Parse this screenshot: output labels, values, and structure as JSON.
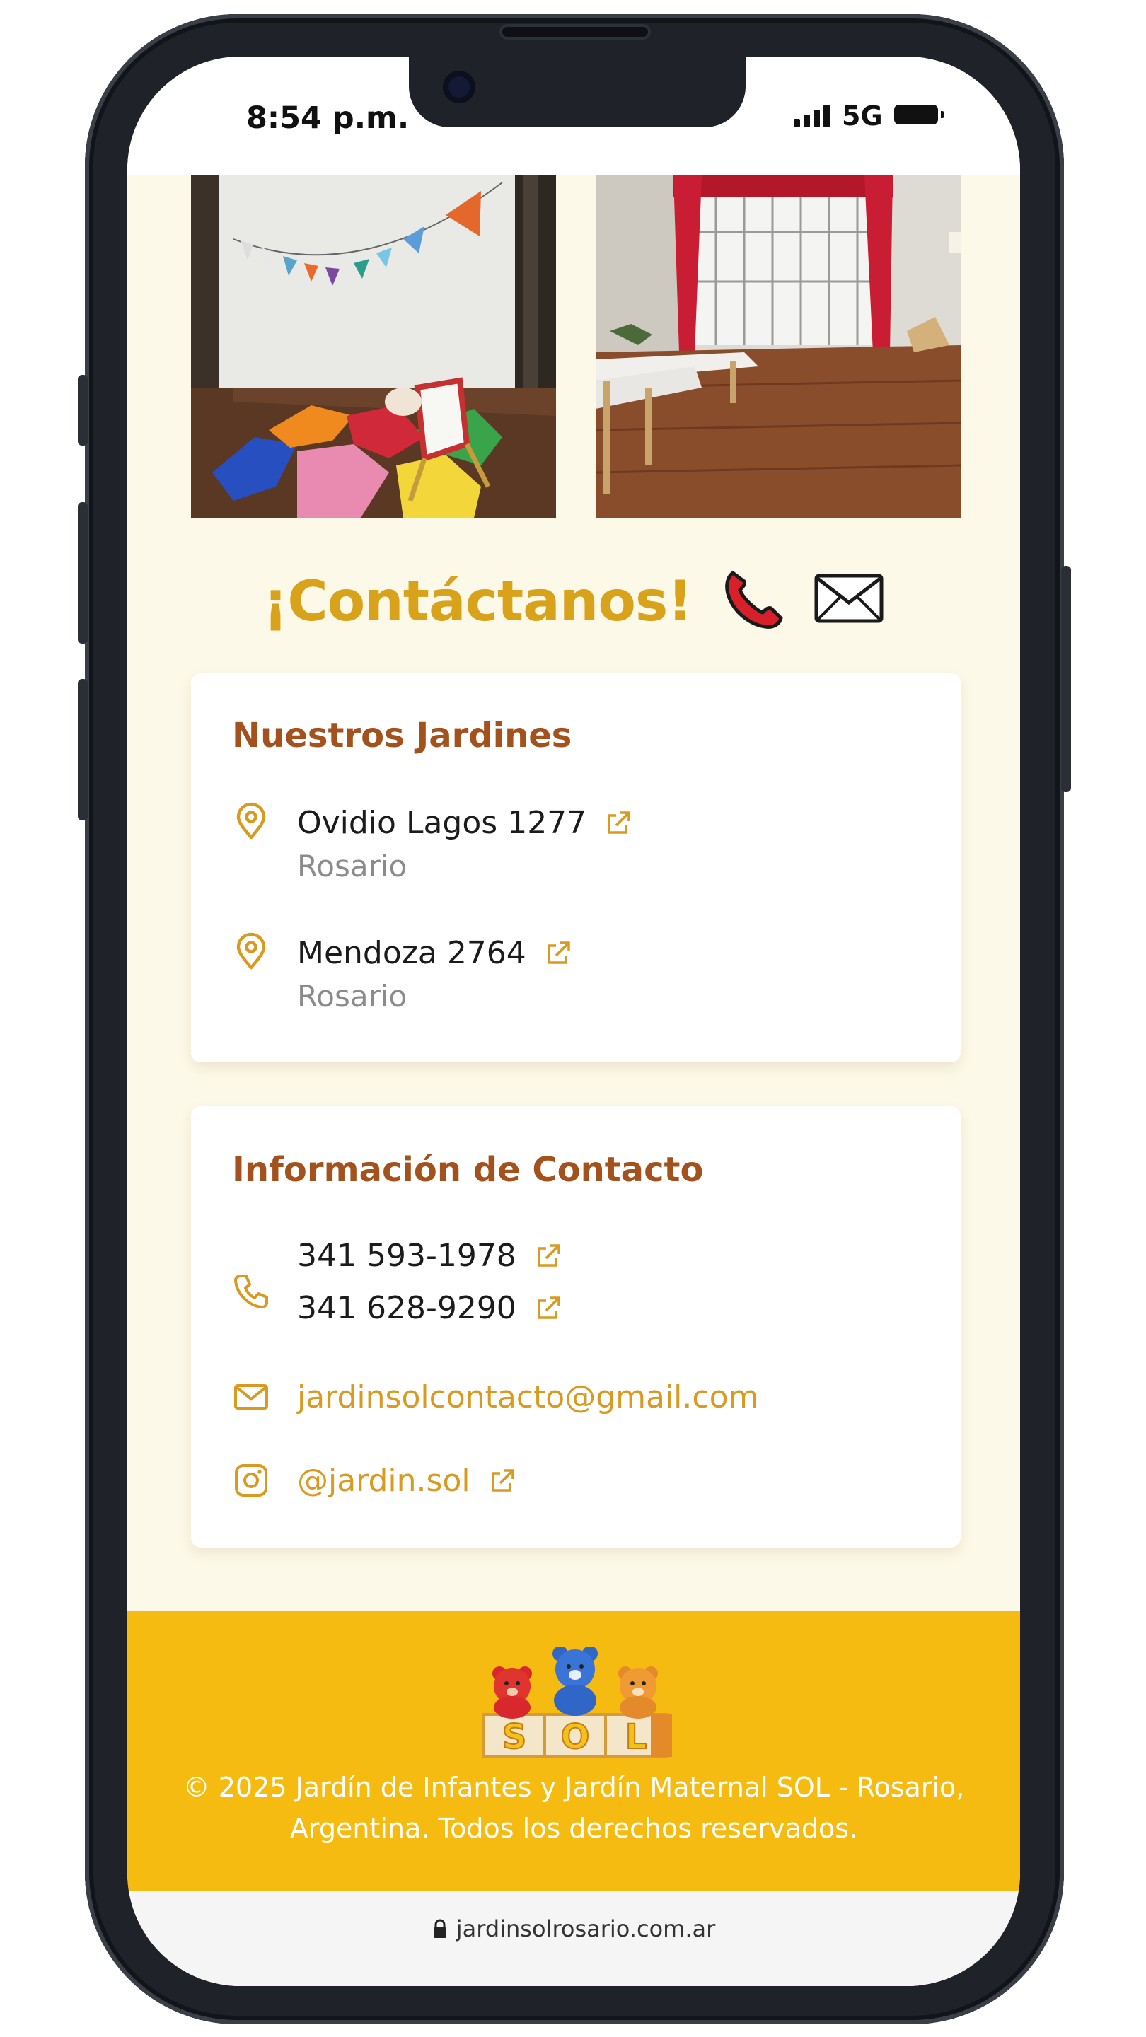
{
  "status_bar": {
    "time": "8:54 p.m.",
    "network": "5G",
    "signal_icon": "signal-bars-icon",
    "battery_icon": "battery-icon"
  },
  "contact": {
    "title": "¡Contáctanos!",
    "emoji": [
      "telephone-receiver-icon",
      "envelope-icon"
    ]
  },
  "gardens": {
    "title": "Nuestros Jardines",
    "items": [
      {
        "address": "Ovidio Lagos 1277",
        "city": "Rosario",
        "icon": "map-pin-icon"
      },
      {
        "address": "Mendoza 2764",
        "city": "Rosario",
        "icon": "map-pin-icon"
      }
    ]
  },
  "contact_info": {
    "title": "Información de Contacto",
    "phones": [
      "341 593-1978",
      "341 628-9290"
    ],
    "email": "jardinsolcontacto@gmail.com",
    "instagram": "@jardin.sol"
  },
  "footer": {
    "logo_letters": "SOL",
    "copyright_line1": "© 2025 Jardín de Infantes y Jardín Maternal SOL - Rosario,",
    "copyright_line2": "Argentina. Todos los derechos reservados."
  },
  "browser": {
    "url": "jardinsolrosario.com.ar"
  },
  "colors": {
    "accent": "#d89a20",
    "title": "#d9a21b",
    "heading": "#a4521d",
    "footer": "#f6bb10",
    "background": "#fdf9e8"
  }
}
